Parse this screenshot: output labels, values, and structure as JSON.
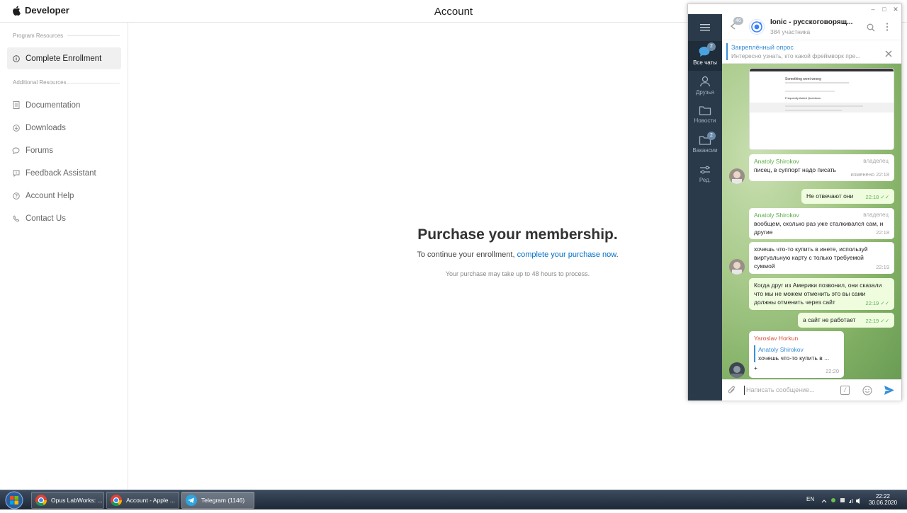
{
  "apple": {
    "brand": "Developer",
    "page_title": "Account",
    "sidebar": {
      "program_title": "Program Resources",
      "additional_title": "Additional Resources",
      "active_item": "Complete Enrollment",
      "items": [
        "Documentation",
        "Downloads",
        "Forums",
        "Feedback Assistant",
        "Account Help",
        "Contact Us"
      ]
    },
    "main": {
      "heading": "Purchase your membership.",
      "text_before": "To continue your enrollment, ",
      "link": "complete your purchase now",
      "text_after": ".",
      "subtext": "Your purchase may take up to 48 hours to process."
    }
  },
  "telegram": {
    "back_badge": "46",
    "chat_name": "Ionic - русскоговорящ...",
    "members": "384 участника",
    "rail": [
      {
        "label": "Все чаты",
        "badge": "2"
      },
      {
        "label": "Друзья",
        "badge": ""
      },
      {
        "label": "Новости",
        "badge": ""
      },
      {
        "label": "Вакансии",
        "badge": "2"
      },
      {
        "label": "Ред.",
        "badge": ""
      }
    ],
    "pinned_title": "Закреплённый опрос",
    "pinned_text": "Интересно узнать, кто какой фреймворк пре...",
    "screenshot": {
      "title": "Something went wrong",
      "faq": "Frequently Asked Questions"
    },
    "messages": [
      {
        "author": "Anatoly Shirokov",
        "role": "владелец",
        "text": "писец, в суппорт надо писать",
        "time": "изменено 22:18"
      },
      {
        "text": "Не отвечают они",
        "time": "22:18"
      },
      {
        "author": "Anatoly Shirokov",
        "role": "владелец",
        "text": "вообщем, сколько раз уже сталкивался сам, и другие",
        "time": "22:18"
      },
      {
        "text": "хочешь что-то купить в инете, используй виртуальную карту с только требуемой суммой",
        "time": "22:19"
      },
      {
        "text": "Когда друг из Америки позвонил, они сказали что мы не можем отменить это вы сами должны отменить через сайт",
        "time": "22:19"
      },
      {
        "text": "а сайт не работает",
        "time": "22:19"
      },
      {
        "author": "Yaroslav Horkun",
        "reply_author": "Anatoly Shirokov",
        "reply_text": "хочешь что-то купить в ...",
        "text": "+",
        "time": "22:20"
      }
    ],
    "input_placeholder": "Написать сообщение..."
  },
  "taskbar": {
    "tasks": [
      {
        "label": "Opus LabWorks: ..."
      },
      {
        "label": "Account - Apple ..."
      },
      {
        "label": "Telegram (1146)"
      }
    ],
    "lang": "EN",
    "time": "22:22",
    "date": "30.06.2020"
  },
  "colors": {
    "link": "#0070c9",
    "telegram_accent": "#3a8fd6",
    "telegram_rail": "#2b3a4a",
    "green_author": "#5aac44",
    "red_author": "#d3503a"
  }
}
